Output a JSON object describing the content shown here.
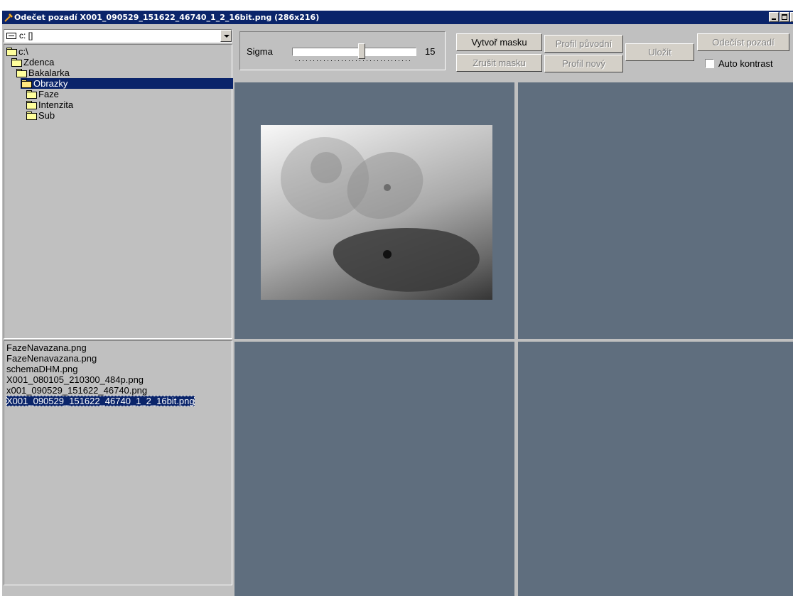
{
  "window": {
    "title": "Odečet pozadí  X001_090529_151622_46740_1_2_16bit.png (286x216)"
  },
  "drive": {
    "label": "c: []"
  },
  "tree": {
    "items": [
      {
        "label": "c:\\",
        "indent": 0,
        "selected": false
      },
      {
        "label": "Zdenca",
        "indent": 1,
        "selected": false
      },
      {
        "label": "Bakalarka",
        "indent": 2,
        "selected": false
      },
      {
        "label": "Obrazky",
        "indent": 3,
        "selected": true
      },
      {
        "label": "Faze",
        "indent": 4,
        "selected": false
      },
      {
        "label": "Intenzita",
        "indent": 4,
        "selected": false
      },
      {
        "label": "Sub",
        "indent": 4,
        "selected": false
      }
    ]
  },
  "files": {
    "items": [
      {
        "label": "FazeNavazana.png",
        "selected": false
      },
      {
        "label": "FazeNenavazana.png",
        "selected": false
      },
      {
        "label": "schemaDHM.png",
        "selected": false
      },
      {
        "label": "X001_080105_210300_484p.png",
        "selected": false
      },
      {
        "label": "x001_090529_151622_46740.png",
        "selected": false
      },
      {
        "label": "X001_090529_151622_46740_1_2_16bit.png",
        "selected": true
      }
    ]
  },
  "sigma": {
    "label": "Sigma",
    "value": "15"
  },
  "buttons": {
    "vytvor_masku": "Vytvoř masku",
    "zrusit_masku": "Zrušit masku",
    "profil_puvodni": "Profil původní",
    "profil_novy": "Profil nový",
    "ulozit": "Uložit",
    "odecist_pozadi": "Odečíst pozadí"
  },
  "auto_kontrast": {
    "label": "Auto kontrast",
    "checked": false
  },
  "colors": {
    "titlebar": "#0a246a",
    "selection": "#0a246a",
    "panel": "#5f6e7e",
    "window_face": "#c0c0c0"
  }
}
